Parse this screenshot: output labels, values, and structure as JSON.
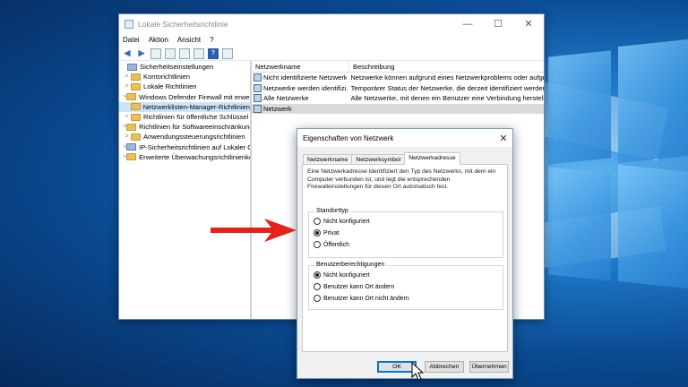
{
  "window": {
    "title": "Lokale Sicherheitsrichtlinie",
    "minimize": "—",
    "maximize": "☐",
    "close": "✕"
  },
  "menu": [
    "Datei",
    "Aktion",
    "Ansicht",
    "?"
  ],
  "tree": {
    "root": "Sicherheitseinstellungen",
    "items": [
      "Kontorichtlinien",
      "Lokale Richtlinien",
      "Windows Defender Firewall mit erweit",
      "Netzwerklisten-Manager-Richtlinien",
      "Richtlinien für öffentliche Schlüssel",
      "Richtlinien für Softwareeinschränkung",
      "Anwendungssteuerungsrichtlinien",
      "IP-Sicherheitsrichtlinien auf Lokaler C",
      "Erweiterte Überwachungsrichtlinienko"
    ],
    "selected_index": 3
  },
  "list": {
    "headers": [
      "Netzwerkname",
      "Beschreibung"
    ],
    "rows": [
      {
        "name": "Nicht identifizierte Netzwerke",
        "desc": "Netzwerke können aufgrund eines Netzwerkproblems oder aufgru"
      },
      {
        "name": "Netzwerke werden identifizi...",
        "desc": "Temporärer Status der Netzwerke, die derzeit identifiziert werden."
      },
      {
        "name": "Alle Netzwerke",
        "desc": "Alle Netzwerke, mit denen ein Benutzer eine Verbindung herstellt."
      },
      {
        "name": "Netzwerk",
        "desc": ""
      }
    ],
    "selected_index": 3
  },
  "dialog": {
    "title": "Eigenschaften von Netzwerk",
    "close": "✕",
    "tabs": [
      "Netzwerkname",
      "Netzwerksymbol",
      "Netzwerkadresse"
    ],
    "active_tab": 2,
    "description": "Eine Netzwerkadresse identifiziert den Typ des Netzwerks, mit dem ein Computer verbunden ist, und legt die entsprechenden Firewalleinstellungen für diesen Ort automatisch fest.",
    "location_group": {
      "legend": "Standorttyp",
      "options": [
        "Nicht konfiguriert",
        "Privat",
        "Öffentlich"
      ],
      "selected": "Privat"
    },
    "permissions_group": {
      "legend": "Benutzerberechtigungen",
      "options": [
        "Nicht konfiguriert",
        "Benutzer kann Ort ändern",
        "Benutzer kann Ort nicht ändern"
      ],
      "selected": "Nicht konfiguriert"
    },
    "buttons": {
      "ok": "OK",
      "cancel": "Abbrechen",
      "apply": "Übernehmen"
    }
  },
  "colors": {
    "accent": "#0078d7",
    "arrow": "#e8201c",
    "selection": "#cce4f7"
  }
}
